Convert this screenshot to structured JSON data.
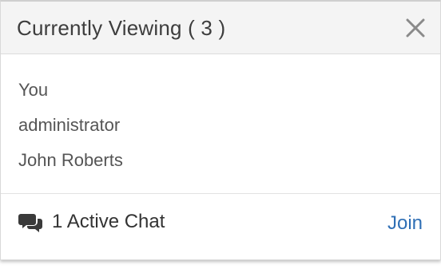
{
  "panel": {
    "title": "Currently Viewing ( 3 )",
    "close_icon": "close-icon"
  },
  "viewers": [
    {
      "name": "You"
    },
    {
      "name": "administrator"
    },
    {
      "name": "John Roberts"
    }
  ],
  "footer": {
    "chat_icon": "chat-bubbles-icon",
    "chat_text": "1 Active Chat",
    "join_label": "Join"
  },
  "colors": {
    "header_bg": "#f4f4f4",
    "link": "#2f6fb5",
    "text_muted": "#555555"
  }
}
